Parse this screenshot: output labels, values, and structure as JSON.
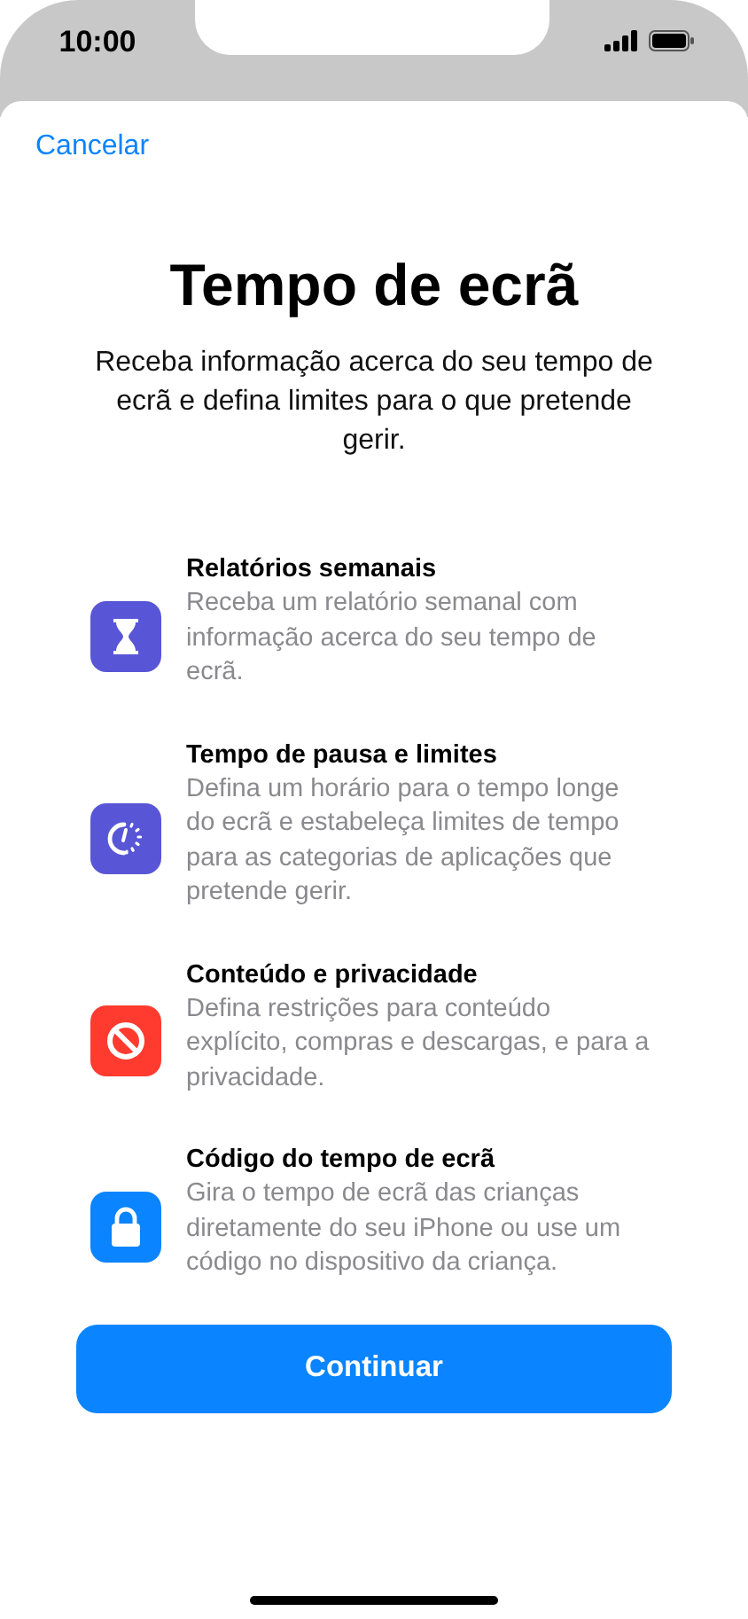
{
  "status_bar": {
    "time": "10:00"
  },
  "cancel": "Cancelar",
  "title": "Tempo de ecrã",
  "subtitle": "Receba informação acerca do seu tempo de ecrã e defina limites para o que pretende gerir.",
  "features": [
    {
      "kind": "hourglass",
      "color": "#5856d6",
      "title": "Relatórios semanais",
      "text": "Receba um relatório semanal com informação acerca do seu tempo de ecrã."
    },
    {
      "kind": "downtime",
      "color": "#5856d6",
      "title": "Tempo de pausa e limites",
      "text": "Defina um horário para o tempo longe do ecrã e estabeleça limites de tempo para as categorias de aplicações que pretende gerir."
    },
    {
      "kind": "restriction",
      "color": "#ff3b30",
      "title": "Conteúdo e privacidade",
      "text": "Defina restrições para conteúdo explícito, compras e descargas, e para a privacidade."
    },
    {
      "kind": "lock",
      "color": "#0a84ff",
      "title": "Código do tempo de ecrã",
      "text": "Gira o tempo de ecrã das crianças diretamente do seu iPhone ou use um código no dispositivo da criança."
    }
  ],
  "button": "Continuar"
}
